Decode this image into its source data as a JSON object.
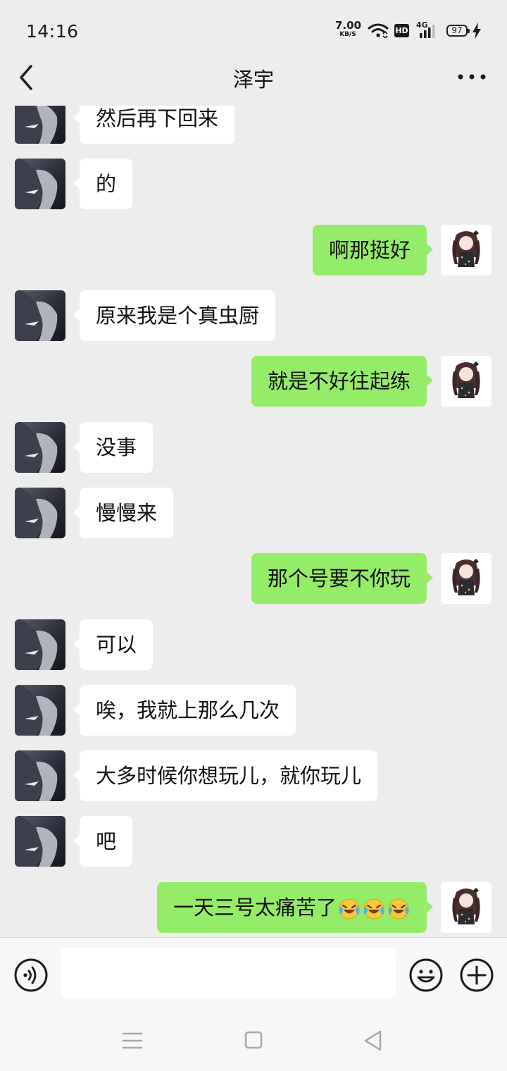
{
  "status_bar": {
    "time": "14:16",
    "net_speed_value": "7.00",
    "net_speed_unit": "KB/S",
    "hd_label": "HD",
    "network_label": "4G",
    "battery_level": "97"
  },
  "nav": {
    "title": "泽宇"
  },
  "messages": [
    {
      "side": "left",
      "text": "然后再下回来"
    },
    {
      "side": "left",
      "text": "的"
    },
    {
      "side": "right",
      "text": "啊那挺好"
    },
    {
      "side": "left",
      "text": "原来我是个真虫厨"
    },
    {
      "side": "right",
      "text": "就是不好往起练"
    },
    {
      "side": "left",
      "text": "没事"
    },
    {
      "side": "left",
      "text": "慢慢来"
    },
    {
      "side": "right",
      "text": "那个号要不你玩"
    },
    {
      "side": "left",
      "text": "可以"
    },
    {
      "side": "left",
      "text": "唉，我就上那么几次"
    },
    {
      "side": "left",
      "text": "大多时候你想玩儿，就你玩儿"
    },
    {
      "side": "left",
      "text": "吧"
    },
    {
      "side": "right",
      "text": "一天三号太痛苦了",
      "emojis": [
        "laughing-crying-emoji",
        "laughing-crying-emoji",
        "laughing-crying-emoji"
      ]
    }
  ],
  "input_bar": {
    "value": "",
    "placeholder": ""
  },
  "colors": {
    "background": "#ededed",
    "sent_bubble": "#95ec69",
    "received_bubble": "#ffffff"
  }
}
